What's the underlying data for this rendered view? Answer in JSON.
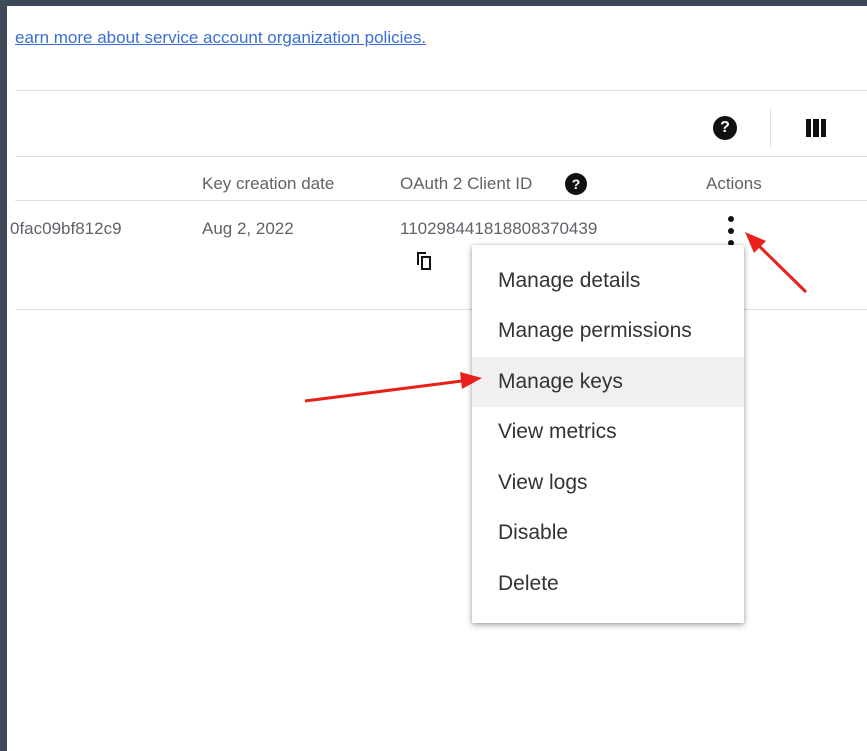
{
  "learn_link": "earn more about service account organization policies.",
  "toolbar": {
    "help_icon": "?",
    "columns_icon": "columns-icon"
  },
  "table": {
    "headers": [
      "Key creation date",
      "OAuth 2 Client ID",
      "Actions"
    ],
    "row": {
      "key_id_partial": "0fac09bf812c9",
      "key_creation_date": "Aug 2, 2022",
      "oauth_client_id": "110298441818808370439"
    }
  },
  "menu": {
    "items": [
      "Manage details",
      "Manage permissions",
      "Manage keys",
      "View metrics",
      "View logs",
      "Disable",
      "Delete"
    ],
    "highlighted_index": 2
  },
  "colors": {
    "link": "#3b6fd4",
    "annotation_arrow": "#e8221b",
    "frame": "#3e4a58"
  }
}
